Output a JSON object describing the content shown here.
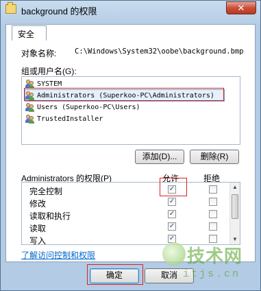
{
  "window": {
    "title": "background 的权限",
    "close_label": "✕"
  },
  "tabs": [
    {
      "label": "安全"
    }
  ],
  "object": {
    "label": "对象名称:",
    "value": "C:\\Windows\\System32\\oobe\\background.bmp"
  },
  "groups": {
    "label": "组或用户名(G):",
    "users": [
      {
        "name": "SYSTEM"
      },
      {
        "name": "Administrators (Superkoo-PC\\Administrators)"
      },
      {
        "name": "Users (Superkoo-PC\\Users)"
      },
      {
        "name": "TrustedInstaller"
      }
    ],
    "selected_index": 1,
    "add_label": "添加(D)...",
    "remove_label": "删除(R)"
  },
  "permissions": {
    "header": "Administrators 的权限(P)",
    "allow_label": "允许",
    "deny_label": "拒绝",
    "rows": [
      {
        "name": "完全控制",
        "allow": "✓",
        "deny": ""
      },
      {
        "name": "修改",
        "allow": "✓",
        "deny": ""
      },
      {
        "name": "读取和执行",
        "allow": "✓",
        "deny": ""
      },
      {
        "name": "读取",
        "allow": "✓",
        "deny": ""
      },
      {
        "name": "写入",
        "allow": "✓",
        "deny": ""
      }
    ]
  },
  "link": {
    "label": "了解访问控制和权限"
  },
  "footer": {
    "ok_label": "确定",
    "cancel_label": "取消"
  },
  "watermark": {
    "big": "技术网",
    "small": "itjs.cn"
  },
  "colors": {
    "highlight_red": "#d62222",
    "link_blue": "#0066cc"
  }
}
